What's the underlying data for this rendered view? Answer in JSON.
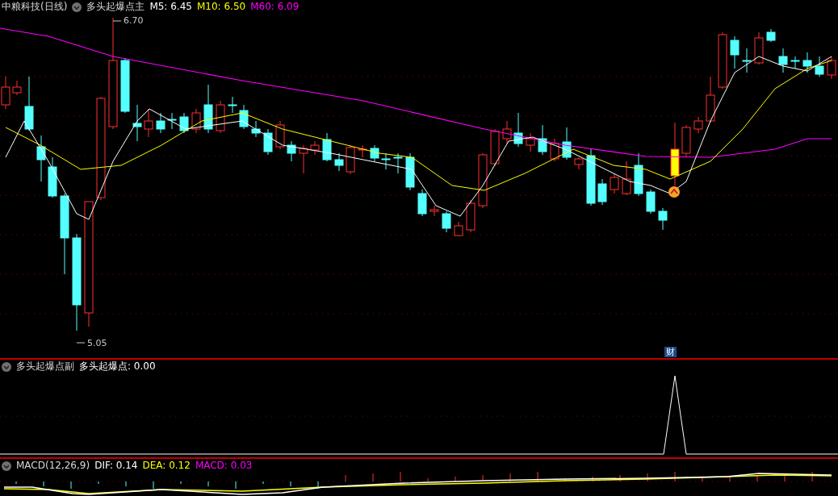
{
  "main_panel": {
    "title": "中粮科技(日线)",
    "indicator": "多头起爆点主",
    "legend": [
      {
        "text": "M5: 6.45",
        "color": "#ffffff"
      },
      {
        "text": "M10: 6.50",
        "color": "#ffff00"
      },
      {
        "text": "M60: 6.09",
        "color": "#ff00ff"
      }
    ],
    "high_label": "6.70",
    "low_label": "5.05",
    "badge": "财"
  },
  "signal_panel": {
    "indicator": "多头起爆点副",
    "legend": [
      {
        "text": "多头起爆点: 0.00",
        "color": "#ffffff"
      }
    ]
  },
  "macd_panel": {
    "indicator": "MACD(12,26,9)",
    "legend": [
      {
        "text": "DIF: 0.14",
        "color": "#ffffff"
      },
      {
        "text": "DEA: 0.12",
        "color": "#ffff00"
      },
      {
        "text": "MACD: 0.03",
        "color": "#ff00ff"
      }
    ]
  }
}
